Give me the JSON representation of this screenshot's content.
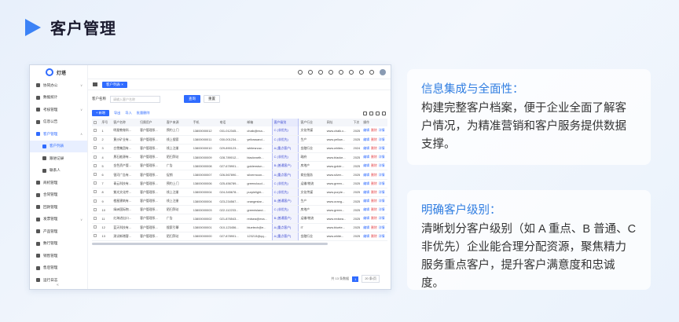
{
  "page": {
    "title": "客户管理"
  },
  "app": {
    "logo_text": "灯塔",
    "sidebar": {
      "items": [
        {
          "label": "协同办公",
          "level": 0,
          "state": "",
          "arrow": "∨"
        },
        {
          "label": "数据统计",
          "level": 0,
          "state": "",
          "arrow": ""
        },
        {
          "label": "考核管理",
          "level": 0,
          "state": "",
          "arrow": "∨"
        },
        {
          "label": "信息公告",
          "level": 0,
          "state": "",
          "arrow": ""
        },
        {
          "label": "客户管理",
          "level": 0,
          "state": "active-parent",
          "arrow": "∧"
        },
        {
          "label": "客户列表",
          "level": 1,
          "state": "active",
          "arrow": ""
        },
        {
          "label": "跟进记录",
          "level": 1,
          "state": "",
          "arrow": ""
        },
        {
          "label": "联系人",
          "level": 1,
          "state": "",
          "arrow": ""
        },
        {
          "label": "商机管理",
          "level": 0,
          "state": "",
          "arrow": ""
        },
        {
          "label": "合同管理",
          "level": 0,
          "state": "",
          "arrow": ""
        },
        {
          "label": "回款管理",
          "level": 0,
          "state": "",
          "arrow": ""
        },
        {
          "label": "发票管理",
          "level": 0,
          "state": "",
          "arrow": "∨"
        },
        {
          "label": "产品管理",
          "level": 0,
          "state": "",
          "arrow": ""
        },
        {
          "label": "数行管理",
          "level": 0,
          "state": "",
          "arrow": ""
        },
        {
          "label": "销售管理",
          "level": 0,
          "state": "",
          "arrow": ""
        },
        {
          "label": "售后管理",
          "level": 0,
          "state": "",
          "arrow": ""
        },
        {
          "label": "运行日志",
          "level": 0,
          "state": "",
          "arrow": ""
        }
      ],
      "collapse": "«"
    },
    "tab": {
      "label": "客户列表 ×"
    },
    "search": {
      "label": "客户名称",
      "placeholder": "请输入客户名称",
      "query_btn": "查询",
      "reset_btn": "重置"
    },
    "toolbar": {
      "add": "+ 新增",
      "export": "导出",
      "import": "导入",
      "batch_delete": "批量删除"
    },
    "table": {
      "headers": [
        "",
        "序号",
        "客户名称",
        "归属用户",
        "客户来源",
        "手机",
        "电话",
        "邮箱",
        "客户级别",
        "客户行业",
        "网址",
        "下次",
        "操作"
      ],
      "rows": [
        {
          "no": "1",
          "name": "明星教育科...",
          "owner": "客户管理系...",
          "source": "预约上门",
          "mobile": "13800000012",
          "phone": "031-012345...",
          "email": "chalk@exa...",
          "level": "C (非优先)",
          "industry": "文化传媒",
          "url": "www.chalk.c...",
          "next": "2025"
        },
        {
          "no": "2",
          "name": "黄沙矿业有...",
          "owner": "客户管理系...",
          "source": "线上搜索",
          "mobile": "13800000011",
          "phone": "030-001234...",
          "email": "yellowsand...",
          "level": "C (非优先)",
          "industry": "生产",
          "url": "www.yellow...",
          "next": "2025"
        },
        {
          "no": "3",
          "name": "白雪集团有...",
          "owner": "客户管理系...",
          "source": "线上注册",
          "mobile": "13800000010",
          "phone": "029-890123...",
          "email": "whitesnow...",
          "level": "A (重点客户)",
          "industry": "金融行业",
          "url": "www.whites...",
          "next": "2024"
        },
        {
          "no": "4",
          "name": "黑石能源有...",
          "owner": "客户管理系...",
          "source": "陌扫拜访",
          "mobile": "13800000009",
          "phone": "028-789012...",
          "email": "blackearth...",
          "level": "C (非优先)",
          "industry": "政府",
          "url": "www.blacke...",
          "next": "2025"
        },
        {
          "no": "5",
          "name": "金色资产管...",
          "owner": "客户管理系...",
          "source": "广告",
          "mobile": "13800000008",
          "phone": "027-678901...",
          "email": "goldenstun...",
          "level": "B (普通客户)",
          "industry": "房地产",
          "url": "www.golde...",
          "next": "2025"
        },
        {
          "no": "6",
          "name": "银河广告有...",
          "owner": "客户管理系...",
          "source": "促销",
          "mobile": "13800000007",
          "phone": "026-567890...",
          "email": "silvermoon...",
          "level": "A (重点客户)",
          "industry": "商业服务",
          "url": "www.silver...",
          "next": "2025"
        },
        {
          "no": "7",
          "name": "青云科技有...",
          "owner": "客户管理系...",
          "source": "预约上门",
          "mobile": "13800000006",
          "phone": "025-456789...",
          "email": "greencloud...",
          "level": "C (非优先)",
          "industry": "运输/物流",
          "url": "www.green...",
          "next": "2025"
        },
        {
          "no": "8",
          "name": "紫光文化传...",
          "owner": "客户管理系...",
          "source": "线上注册",
          "mobile": "13800000004",
          "phone": "024-345678...",
          "email": "purplelight...",
          "level": "C (非优先)",
          "industry": "文化传媒",
          "url": "www.purple...",
          "next": "2025"
        },
        {
          "no": "9",
          "name": "橙星建筑有...",
          "owner": "客户管理系...",
          "source": "线上注册",
          "mobile": "13800000004",
          "phone": "023-234567...",
          "email": "orangestar...",
          "level": "B (普通客户)",
          "industry": "生产",
          "url": "www.orang...",
          "next": "2025"
        },
        {
          "no": "10",
          "name": "绿洲国际物...",
          "owner": "客户管理系...",
          "source": "陌扫拜访",
          "mobile": "13800000003",
          "phone": "022-112233...",
          "email": "greenisland...",
          "level": "C (非优先)",
          "industry": "房地产",
          "url": "www.green...",
          "next": "2025"
        },
        {
          "no": "11",
          "name": "红海进出口...",
          "owner": "客户管理系...",
          "source": "广告",
          "mobile": "13800000002",
          "phone": "021-876543...",
          "email": "redsea@exa...",
          "level": "B (普通客户)",
          "industry": "运输/物流",
          "url": "www.redsea...",
          "next": "2025"
        },
        {
          "no": "12",
          "name": "蓝天科技有...",
          "owner": "客户管理系...",
          "source": "搜索引擎",
          "mobile": "13800000001",
          "phone": "010-123456...",
          "email": "bluetech@e...",
          "level": "A (重点客户)",
          "industry": "IT",
          "url": "www.bluete...",
          "next": "2025"
        },
        {
          "no": "13",
          "name": "测试新增客...",
          "owner": "客户管理系...",
          "source": "陌扫拜访",
          "mobile": "13800000000",
          "phone": "027-878901...",
          "email": "123213@qq...",
          "level": "A (重点客户)",
          "industry": "金融行业",
          "url": "www.white...",
          "next": "2025"
        }
      ],
      "ops": {
        "edit": "编辑",
        "delete": "删除",
        "detail": "详情"
      }
    },
    "pager": {
      "total": "共 13 条数据",
      "page": "1",
      "size": "20 条/页"
    }
  },
  "cards": [
    {
      "title": "信息集成与全面性：",
      "body": "构建完整客户档案，便于企业全面了解客户情况，为精准营销和客户服务提供数据支撑。"
    },
    {
      "title": "明确客户级别：",
      "body": "清晰划分客户级别（如 A 重点、B 普通、C 非优先）企业能合理分配资源，聚焦精力服务重点客户，提升客户满意度和忠诚度。"
    }
  ]
}
